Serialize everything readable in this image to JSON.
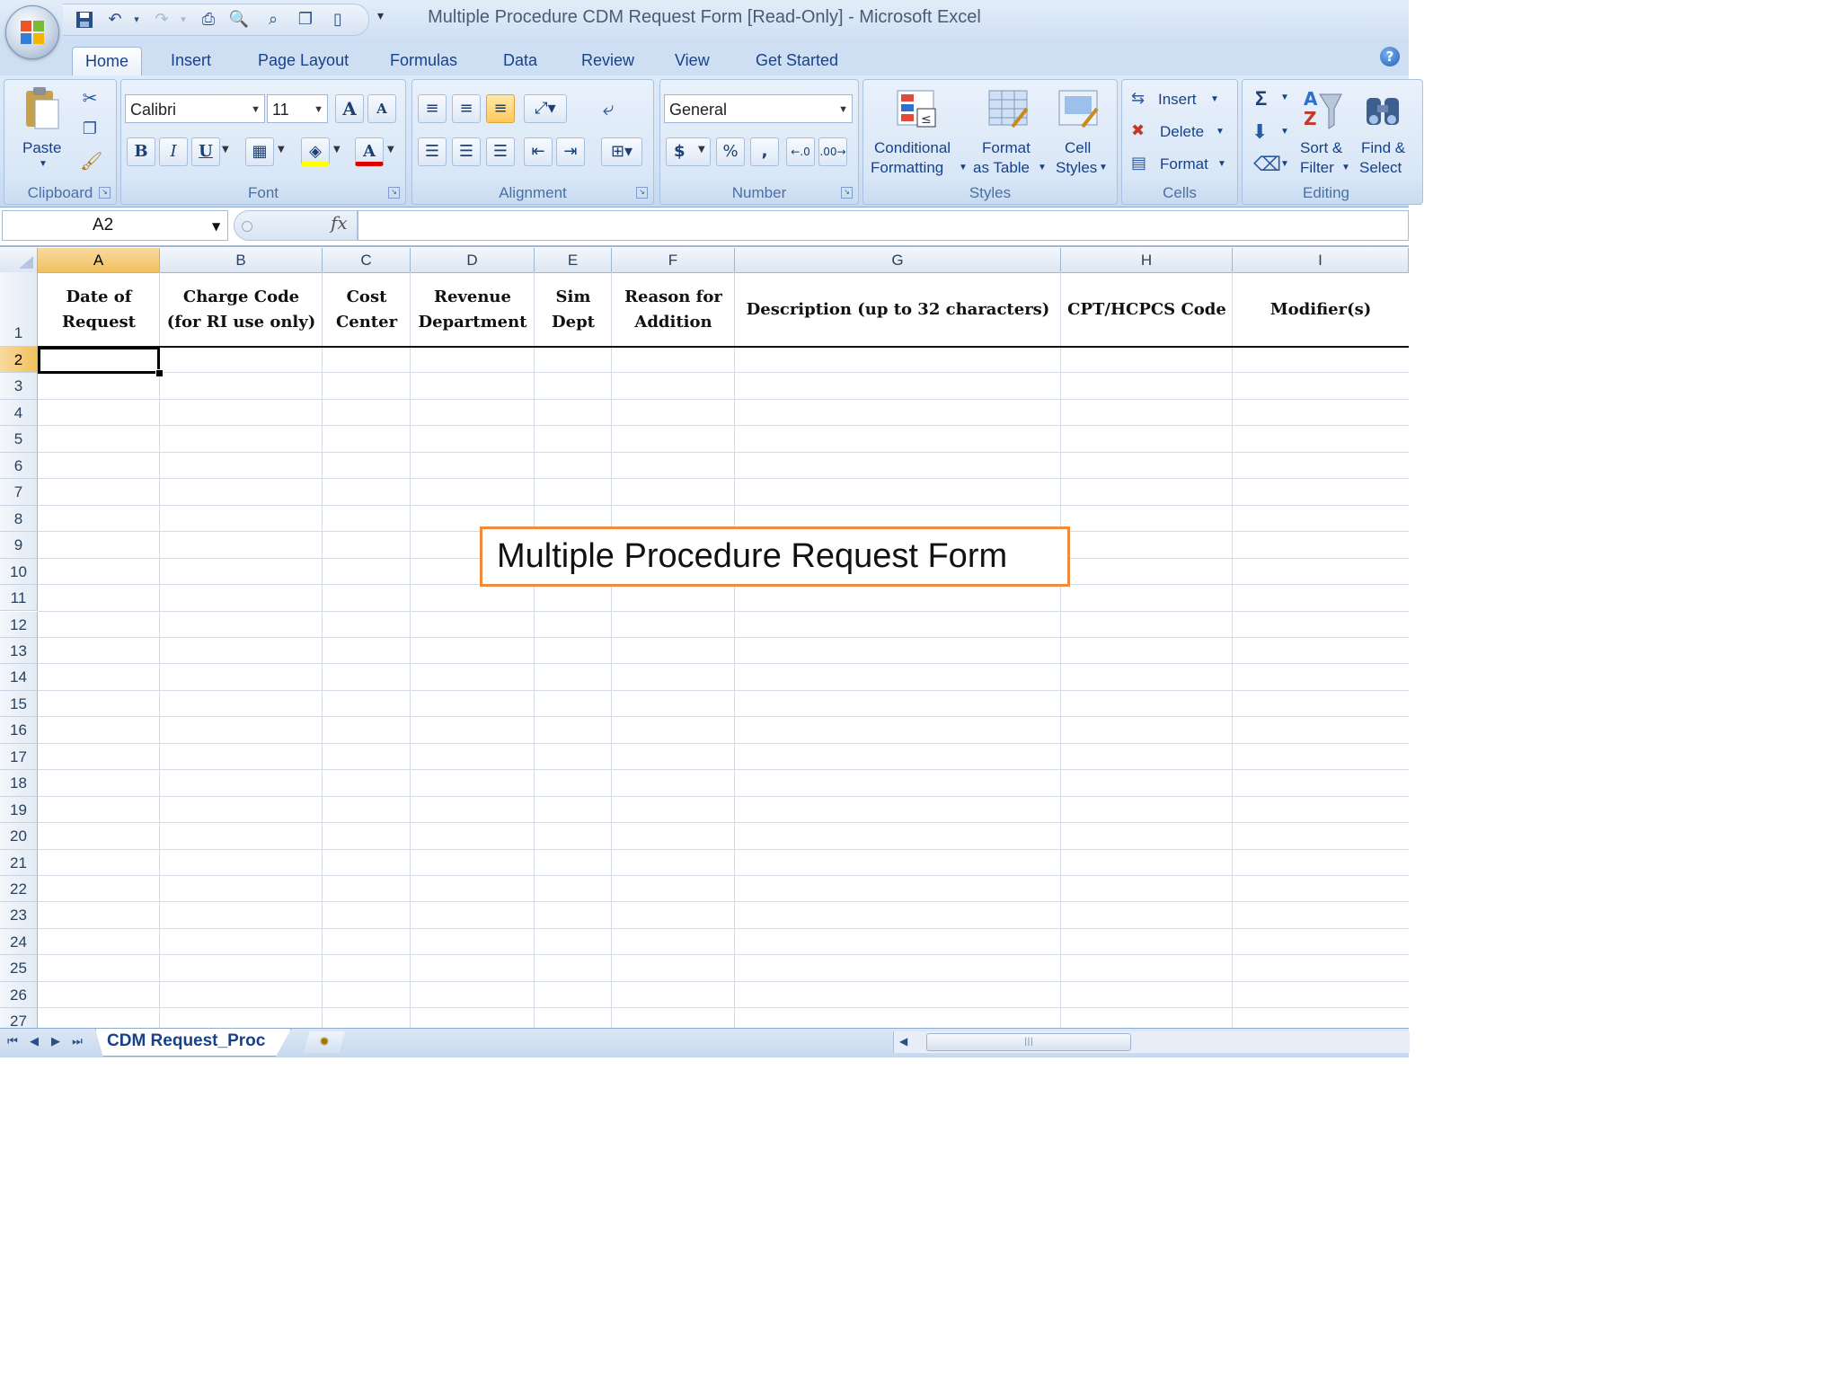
{
  "window": {
    "title": "Multiple Procedure CDM Request Form  [Read-Only]  -  Microsoft Excel"
  },
  "tabs": [
    "Home",
    "Insert",
    "Page Layout",
    "Formulas",
    "Data",
    "Review",
    "View",
    "Get Started"
  ],
  "active_tab": "Home",
  "ribbon": {
    "clipboard": {
      "label": "Clipboard",
      "paste": "Paste"
    },
    "font": {
      "label": "Font",
      "font_name": "Calibri",
      "font_size": "11",
      "bold": "B",
      "italic": "I",
      "underline": "U",
      "grow": "A",
      "shrink": "A",
      "font_color": "A"
    },
    "alignment": {
      "label": "Alignment"
    },
    "number": {
      "label": "Number",
      "format": "General",
      "currency": "$",
      "percent": "%",
      "comma": ","
    },
    "styles": {
      "label": "Styles",
      "conditional_1": "Conditional",
      "conditional_2": "Formatting",
      "format_table_1": "Format",
      "format_table_2": "as Table",
      "cell_styles_1": "Cell",
      "cell_styles_2": "Styles"
    },
    "cells": {
      "label": "Cells",
      "insert": "Insert",
      "delete": "Delete",
      "format": "Format"
    },
    "editing": {
      "label": "Editing",
      "sigma": "Σ",
      "sort_1": "Sort &",
      "sort_2": "Filter",
      "find_1": "Find &",
      "find_2": "Select"
    }
  },
  "formula_bar": {
    "name_box": "A2",
    "fx": "fx",
    "content": ""
  },
  "grid": {
    "columns": [
      "A",
      "B",
      "C",
      "D",
      "E",
      "F",
      "G",
      "H",
      "I"
    ],
    "selected_column": "A",
    "selected_row": "2",
    "rows": [
      "1",
      "2",
      "3",
      "4",
      "5",
      "6",
      "7",
      "8",
      "9",
      "10",
      "11",
      "12",
      "13",
      "14",
      "15",
      "16",
      "17",
      "18",
      "19",
      "20",
      "21",
      "22",
      "23",
      "24",
      "25",
      "26",
      "27"
    ],
    "header_row": {
      "a_1": "Date of",
      "a_2": "Request",
      "b_1": "Charge Code",
      "b_2": "(for RI use only)",
      "c_1": "Cost",
      "c_2": "Center",
      "d_1": "Revenue",
      "d_2": "Department",
      "e_1": "Sim",
      "e_2": "Dept",
      "f_1": "Reason for",
      "f_2": "Addition",
      "g": "Description (up to 32  characters)",
      "h": "CPT/HCPCS Code",
      "i": "Modifier(s)"
    }
  },
  "textbox": {
    "text": "Multiple Procedure Request Form",
    "border_color": "#f18a3b"
  },
  "sheet_tabs": {
    "active": "CDM Request_Proc"
  }
}
